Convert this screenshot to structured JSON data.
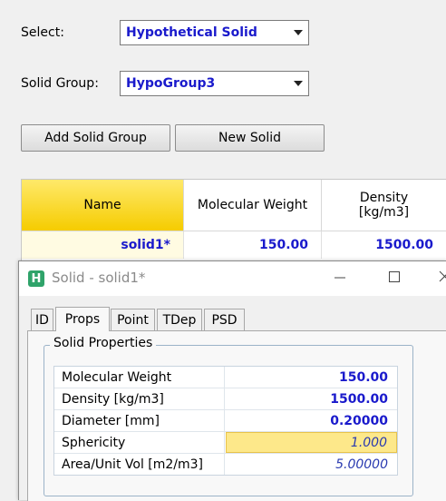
{
  "top": {
    "select_label": "Select:",
    "select_value": "Hypothetical Solid",
    "group_label": "Solid Group:",
    "group_value": "HypoGroup3",
    "add_group_button": "Add Solid Group",
    "new_solid_button": "New Solid"
  },
  "grid": {
    "headers": [
      "Name",
      "Molecular Weight",
      "Density\n[kg/m3]"
    ],
    "row": [
      "solid1*",
      "150.00",
      "1500.00"
    ]
  },
  "dialog": {
    "title": "Solid - solid1*",
    "app_icon": "H",
    "tabs": [
      "ID",
      "Props",
      "Point",
      "TDep",
      "PSD"
    ],
    "active_tab": "Props",
    "group_title": "Solid Properties",
    "properties": [
      {
        "name": "Molecular Weight",
        "value": "150.00"
      },
      {
        "name": "Density [kg/m3]",
        "value": "1500.00"
      },
      {
        "name": "Diameter [mm]",
        "value": "0.20000"
      },
      {
        "name": "Sphericity",
        "value": "1.000"
      },
      {
        "name": "Area/Unit Vol [m2/m3]",
        "value": "5.00000"
      }
    ]
  },
  "colors": {
    "value_blue": "#1a1acc",
    "name_header_gold": "#f5cc00",
    "highlight_yellow": "#fde88a"
  }
}
